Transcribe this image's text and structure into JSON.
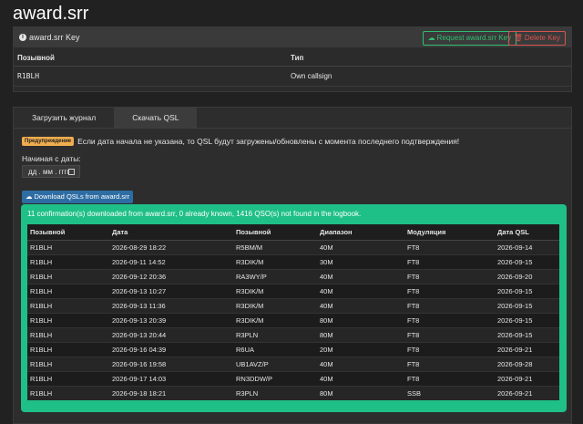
{
  "page_title": "award.srr",
  "key_card": {
    "title": "award.srr Key",
    "request_button": "Request award.srr Key",
    "delete_button": "Delete Key",
    "columns": [
      "Позывной",
      "Тип"
    ],
    "row": {
      "callsign": "R1BLH",
      "type": "Own callsign"
    }
  },
  "tabs": [
    "Загрузить журнал",
    "Скачать QSL"
  ],
  "active_tab": "Скачать QSL",
  "warning": {
    "badge": "Предупреждение",
    "text": "Если дата начала не указана, то QSL будут загружены/обновлены с момента последнего подтверждения!"
  },
  "date_field": {
    "label": "Начиная с даты:",
    "placeholder": "дд . мм . гггг"
  },
  "download_button": "Download QSLs from award.srr",
  "result_message": "11 confirmation(s) downloaded from award.srr, 0 already known, 1416 QSO(s) not found in the logbook.",
  "table": {
    "headers": [
      "Позывной",
      "Дата",
      "Позывной",
      "Диапазон",
      "Модуляция",
      "Дата QSL"
    ],
    "rows": [
      [
        "R1BLH",
        "2026-08-29 18:22",
        "R5BM/M",
        "40M",
        "FT8",
        "2026-09-14"
      ],
      [
        "R1BLH",
        "2026-09-11 14:52",
        "R3DIK/M",
        "30M",
        "FT8",
        "2026-09-15"
      ],
      [
        "R1BLH",
        "2026-09-12 20:36",
        "RA3WY/P",
        "40M",
        "FT8",
        "2026-09-20"
      ],
      [
        "R1BLH",
        "2026-09-13 10:27",
        "R3DIK/M",
        "40M",
        "FT8",
        "2026-09-15"
      ],
      [
        "R1BLH",
        "2026-09-13 11:36",
        "R3DIK/M",
        "40M",
        "FT8",
        "2026-09-15"
      ],
      [
        "R1BLH",
        "2026-09-13 20:39",
        "R3DIK/M",
        "80M",
        "FT8",
        "2026-09-15"
      ],
      [
        "R1BLH",
        "2026-09-13 20:44",
        "R3PLN",
        "80M",
        "FT8",
        "2026-09-15"
      ],
      [
        "R1BLH",
        "2026-09-16 04:39",
        "R6UA",
        "20M",
        "FT8",
        "2026-09-21"
      ],
      [
        "R1BLH",
        "2026-09-16 19:58",
        "UB1AVZ/P",
        "40M",
        "FT8",
        "2026-09-28"
      ],
      [
        "R1BLH",
        "2026-09-17 14:03",
        "RN3DDW/P",
        "40M",
        "FT8",
        "2026-09-21"
      ],
      [
        "R1BLH",
        "2026-09-18 18:21",
        "R3PLN",
        "80M",
        "SSB",
        "2026-09-21"
      ]
    ]
  },
  "colors": {
    "background": "#212121",
    "success": "#1fbf88",
    "warning": "#f0ad4e",
    "primary": "#2e6da4",
    "danger": "#d9534f",
    "green_outline": "#2fbf71"
  }
}
